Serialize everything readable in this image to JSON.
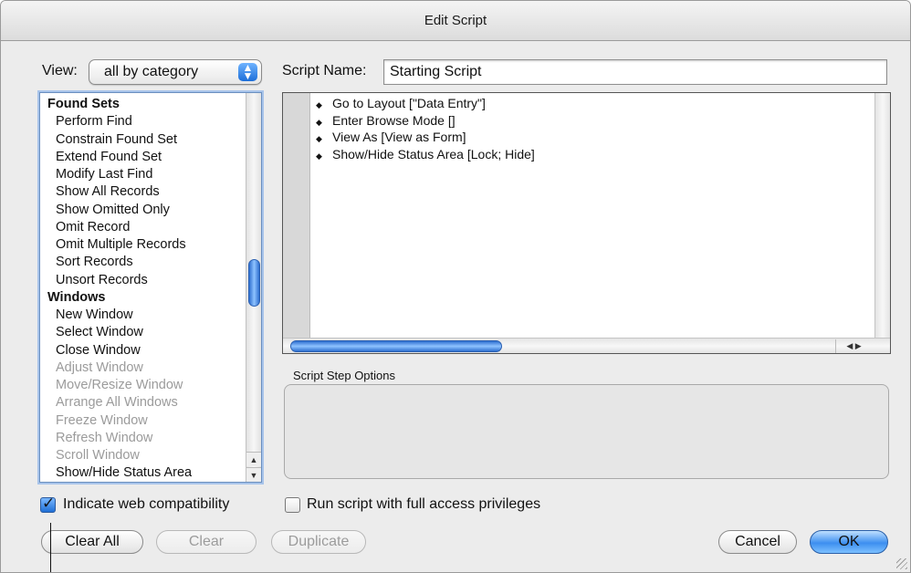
{
  "window": {
    "title": "Edit Script"
  },
  "view": {
    "label": "View:",
    "value": "all by category"
  },
  "script_name": {
    "label": "Script Name:",
    "value": "Starting Script"
  },
  "step_list": [
    {
      "label": "Found Sets",
      "kind": "category",
      "enabled": true
    },
    {
      "label": "Perform Find",
      "kind": "item",
      "enabled": true
    },
    {
      "label": "Constrain Found Set",
      "kind": "item",
      "enabled": true
    },
    {
      "label": "Extend Found Set",
      "kind": "item",
      "enabled": true
    },
    {
      "label": "Modify Last Find",
      "kind": "item",
      "enabled": true
    },
    {
      "label": "Show All Records",
      "kind": "item",
      "enabled": true
    },
    {
      "label": "Show Omitted Only",
      "kind": "item",
      "enabled": true
    },
    {
      "label": "Omit Record",
      "kind": "item",
      "enabled": true
    },
    {
      "label": "Omit Multiple Records",
      "kind": "item",
      "enabled": true
    },
    {
      "label": "Sort Records",
      "kind": "item",
      "enabled": true
    },
    {
      "label": "Unsort Records",
      "kind": "item",
      "enabled": true
    },
    {
      "label": "Windows",
      "kind": "category",
      "enabled": true
    },
    {
      "label": "New Window",
      "kind": "item",
      "enabled": true
    },
    {
      "label": "Select Window",
      "kind": "item",
      "enabled": true
    },
    {
      "label": "Close Window",
      "kind": "item",
      "enabled": true
    },
    {
      "label": "Adjust Window",
      "kind": "item",
      "enabled": false
    },
    {
      "label": "Move/Resize Window",
      "kind": "item",
      "enabled": false
    },
    {
      "label": "Arrange All Windows",
      "kind": "item",
      "enabled": false
    },
    {
      "label": "Freeze Window",
      "kind": "item",
      "enabled": false
    },
    {
      "label": "Refresh Window",
      "kind": "item",
      "enabled": false
    },
    {
      "label": "Scroll Window",
      "kind": "item",
      "enabled": false
    },
    {
      "label": "Show/Hide Status Area",
      "kind": "item",
      "enabled": true
    }
  ],
  "script_steps": [
    "Go to Layout [\"Data Entry\"]",
    "Enter Browse Mode []",
    "View As [View as Form]",
    "Show/Hide Status Area [Lock; Hide]"
  ],
  "options": {
    "label": "Script Step Options"
  },
  "checkboxes": {
    "web_compat": {
      "label": "Indicate web compatibility",
      "checked": true
    },
    "full_access": {
      "label": "Run script with full access privileges",
      "checked": false
    }
  },
  "buttons": {
    "clear_all": "Clear All",
    "clear": "Clear",
    "duplicate": "Duplicate",
    "cancel": "Cancel",
    "ok": "OK"
  },
  "glyphs": {
    "popup_arrows": "▲▼",
    "step_marker": "◆",
    "arrow_up": "▲",
    "arrow_down": "▼",
    "arrow_left": "◀",
    "arrow_right": "▶",
    "check": "✓"
  },
  "colors": {
    "accent": "#2d6fd0",
    "disabled_text": "#9b9b9b"
  }
}
